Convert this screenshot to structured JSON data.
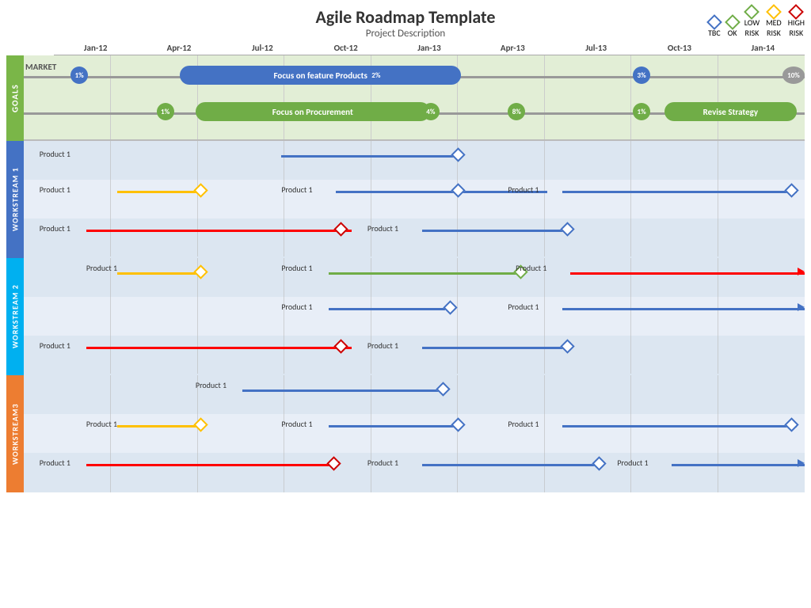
{
  "header": {
    "title": "Agile Roadmap Template",
    "subtitle": "Project Description"
  },
  "legend": {
    "items": [
      {
        "label": "TBC",
        "color": "#4472c4"
      },
      {
        "label": "OK",
        "color": "#70ad47"
      },
      {
        "label": "LOW\nRISK",
        "color": "#70ad47"
      },
      {
        "label": "MED\nRISK",
        "color": "#ffc000"
      },
      {
        "label": "HIGH\nRISK",
        "color": "#cc0000"
      }
    ]
  },
  "timeline": {
    "columns": [
      "Jan-12",
      "Apr-12",
      "Jul-12",
      "Oct-12",
      "Jan-13",
      "Apr-13",
      "Jul-13",
      "Oct-13",
      "Jan-14"
    ]
  },
  "goals": {
    "market_label": "MARKET",
    "row1": {
      "bar_text": "Focus on feature Products",
      "milestones": [
        "1%",
        "2%",
        "3%",
        "10%"
      ]
    },
    "row2": {
      "bar_text": "Focus on Procurement",
      "bar2_text": "Revise Strategy",
      "milestones": [
        "1%",
        "4%",
        "8%",
        "1%"
      ]
    }
  },
  "sections": {
    "goals": "GOALS",
    "ws1": "WORKSTREAM 1",
    "ws2": "WORKSTREAM 2",
    "ws3": "WORKSTREAM3"
  },
  "products": {
    "label": "Product 1"
  }
}
